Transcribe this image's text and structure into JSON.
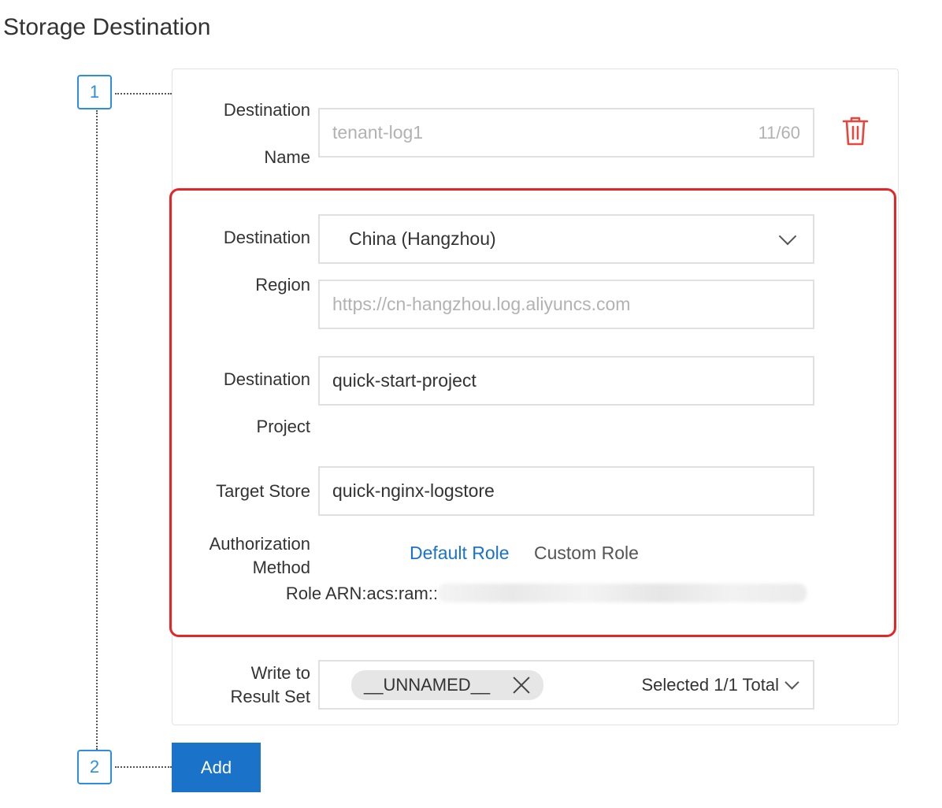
{
  "page": {
    "title": "Storage Destination"
  },
  "steps": [
    "1",
    "2"
  ],
  "destination_name": {
    "label_line1": "Destination",
    "label_line2": "Name",
    "value": "tenant-log1",
    "counter": "11/60"
  },
  "destination_region": {
    "label_line1": "Destination",
    "label_line2": "Region",
    "selected": "China (Hangzhou)",
    "endpoint": "https://cn-hangzhou.log.aliyuncs.com"
  },
  "destination_project": {
    "label_line1": "Destination",
    "label_line2": "Project",
    "value": "quick-start-project"
  },
  "target_store": {
    "label": "Target Store",
    "value": "quick-nginx-logstore"
  },
  "authorization": {
    "label_line1": "Authorization",
    "label_line2": "Method",
    "default_role": "Default Role",
    "custom_role": "Custom Role",
    "role_arn_label": "Role ARN:acs:ram::"
  },
  "result_set": {
    "label_line1": "Write to",
    "label_line2": "Result Set",
    "tag": "__UNNAMED__",
    "summary": "Selected 1/1 Total"
  },
  "actions": {
    "add": "Add"
  },
  "icons": {
    "delete": "trash-icon",
    "dropdown": "chevron-down-icon",
    "remove_tag": "close-icon"
  },
  "colors": {
    "accent": "#1a73c8",
    "highlight_frame": "#e32626",
    "delete_icon": "#e5463d"
  }
}
